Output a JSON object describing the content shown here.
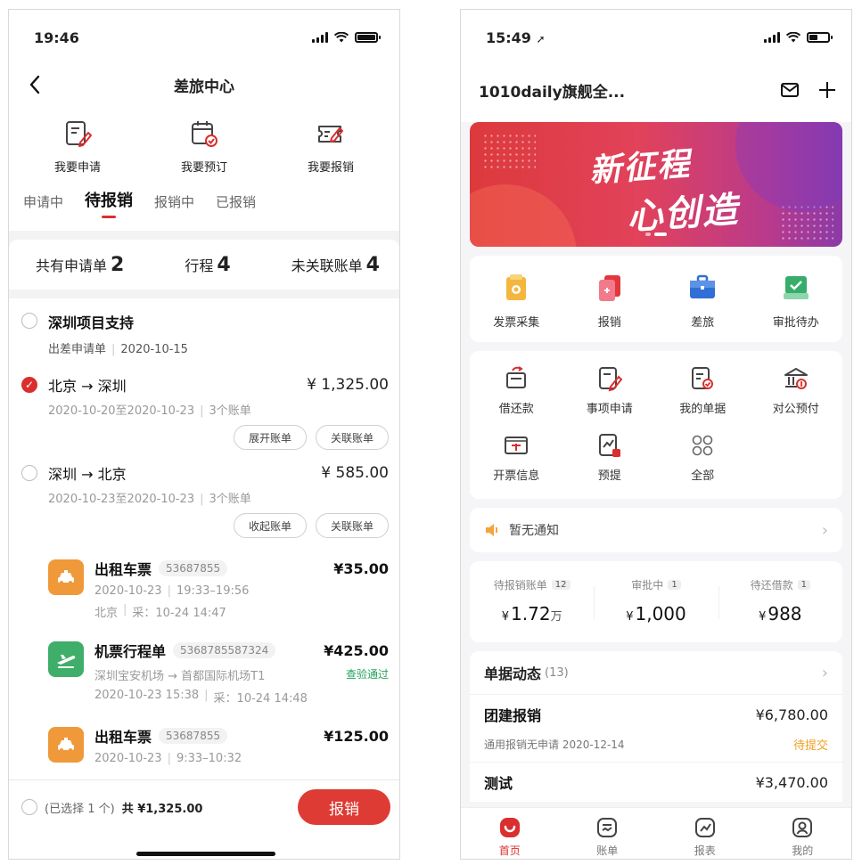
{
  "left": {
    "status": {
      "time": "19:46"
    },
    "nav": {
      "title": "差旅中心"
    },
    "quick_actions": [
      {
        "label": "我要申请",
        "icon": "apply-edit-icon"
      },
      {
        "label": "我要预订",
        "icon": "calendar-booking-icon"
      },
      {
        "label": "我要报销",
        "icon": "ticket-reimburse-icon"
      }
    ],
    "tabs": [
      {
        "label": "申请中",
        "active": false
      },
      {
        "label": "待报销",
        "active": true
      },
      {
        "label": "报销中",
        "active": false
      },
      {
        "label": "已报销",
        "active": false
      }
    ],
    "summary": {
      "applications_label": "共有申请单",
      "applications_count": "2",
      "trips_label": "行程",
      "trips_count": "4",
      "unlinked_label": "未关联账单",
      "unlinked_count": "4"
    },
    "application": {
      "title": "深圳项目支持",
      "type": "出差申请单",
      "date": "2020-10-15"
    },
    "trips": [
      {
        "route": "北京 → 深圳",
        "amount": "¥ 1,325.00",
        "dates": "2020-10-20至2020-10-23",
        "bills": "3个账单",
        "toggle_label": "展开账单",
        "link_label": "关联账单",
        "checked": true
      },
      {
        "route": "深圳 → 北京",
        "amount": "¥ 585.00",
        "dates": "2020-10-23至2020-10-23",
        "bills": "3个账单",
        "toggle_label": "收起账单",
        "link_label": "关联账单",
        "checked": false
      }
    ],
    "bills": [
      {
        "name": "出租车票",
        "number": "53687855",
        "amount": "¥35.00",
        "line1": "2020-10-23",
        "line1b": "19:33–19:56",
        "line2": "北京",
        "line2b": "采：10-24 14:47",
        "status": "",
        "icon": "taxi-icon",
        "color": "#f0993a"
      },
      {
        "name": "机票行程单",
        "number": "5368785587324",
        "amount": "¥425.00",
        "line1": "深圳宝安机场 → 首都国际机场T1",
        "line1b": "",
        "line2": "2020-10-23 15:38",
        "line2b": "采：10-24 14:48",
        "status": "查验通过",
        "icon": "airplane-icon",
        "color": "#3fae6a"
      },
      {
        "name": "出租车票",
        "number": "53687855",
        "amount": "¥125.00",
        "line1": "2020-10-23",
        "line1b": "9:33–10:32",
        "line2": "",
        "line2b": "",
        "status": "",
        "icon": "taxi-icon",
        "color": "#f0993a"
      }
    ],
    "bottom": {
      "selected_text": "(已选择 1 个)",
      "total_text": "共 ¥1,325.00",
      "submit_label": "报销"
    }
  },
  "right": {
    "status": {
      "time": "15:49"
    },
    "header": {
      "title": "1010daily旗舰全..."
    },
    "banner": {
      "line1": "新征程",
      "line2": "心创造",
      "pages": 2,
      "current_page": 2
    },
    "main_grid": [
      {
        "label": "发票采集",
        "icon": "invoice-collect-icon"
      },
      {
        "label": "报销",
        "icon": "reimburse-icon"
      },
      {
        "label": "差旅",
        "icon": "travel-briefcase-icon"
      },
      {
        "label": "审批待办",
        "icon": "approval-todo-icon"
      }
    ],
    "services": [
      {
        "label": "借还款",
        "icon": "loan-icon"
      },
      {
        "label": "事项申请",
        "icon": "item-apply-icon"
      },
      {
        "label": "我的单据",
        "icon": "my-documents-icon"
      },
      {
        "label": "对公预付",
        "icon": "corporate-prepay-icon"
      },
      {
        "label": "开票信息",
        "icon": "invoice-info-icon"
      },
      {
        "label": "预提",
        "icon": "accrual-icon"
      },
      {
        "label": "全部",
        "icon": "all-apps-icon"
      }
    ],
    "notice": {
      "text": "暂无通知"
    },
    "stats": [
      {
        "label": "待报销账单",
        "badge": "12",
        "yen": "¥",
        "value": "1.72",
        "unit": "万"
      },
      {
        "label": "审批中",
        "badge": "1",
        "yen": "¥",
        "value": "1,000",
        "unit": ""
      },
      {
        "label": "待还借款",
        "badge": "1",
        "yen": "¥",
        "value": "988",
        "unit": ""
      }
    ],
    "dynamics": {
      "title": "单据动态",
      "count": "(13)",
      "items": [
        {
          "name": "团建报销",
          "amount": "¥6,780.00",
          "sub": "通用报销无申请 2020-12-14",
          "status": "待提交"
        },
        {
          "name": "测试",
          "amount": "¥3,470.00",
          "sub": "",
          "status": ""
        }
      ]
    },
    "tabbar": [
      {
        "label": "首页",
        "active": true,
        "icon": "home-icon"
      },
      {
        "label": "账单",
        "active": false,
        "icon": "bill-icon"
      },
      {
        "label": "报表",
        "active": false,
        "icon": "report-icon"
      },
      {
        "label": "我的",
        "active": false,
        "icon": "profile-icon"
      }
    ],
    "colors": {
      "accent": "#d92f2f",
      "pending": "#f0a020",
      "verified": "#22a05a"
    }
  }
}
